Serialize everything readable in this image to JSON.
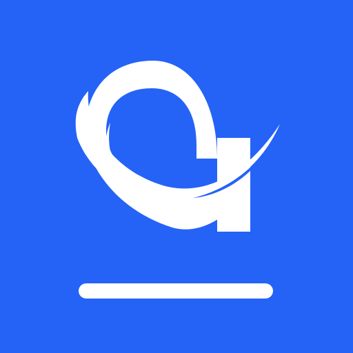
{
  "app_icon": {
    "logo_icon_name": "a-swoosh-logo-icon",
    "background_color": "#2563f7",
    "foreground_color": "#ffffff"
  }
}
